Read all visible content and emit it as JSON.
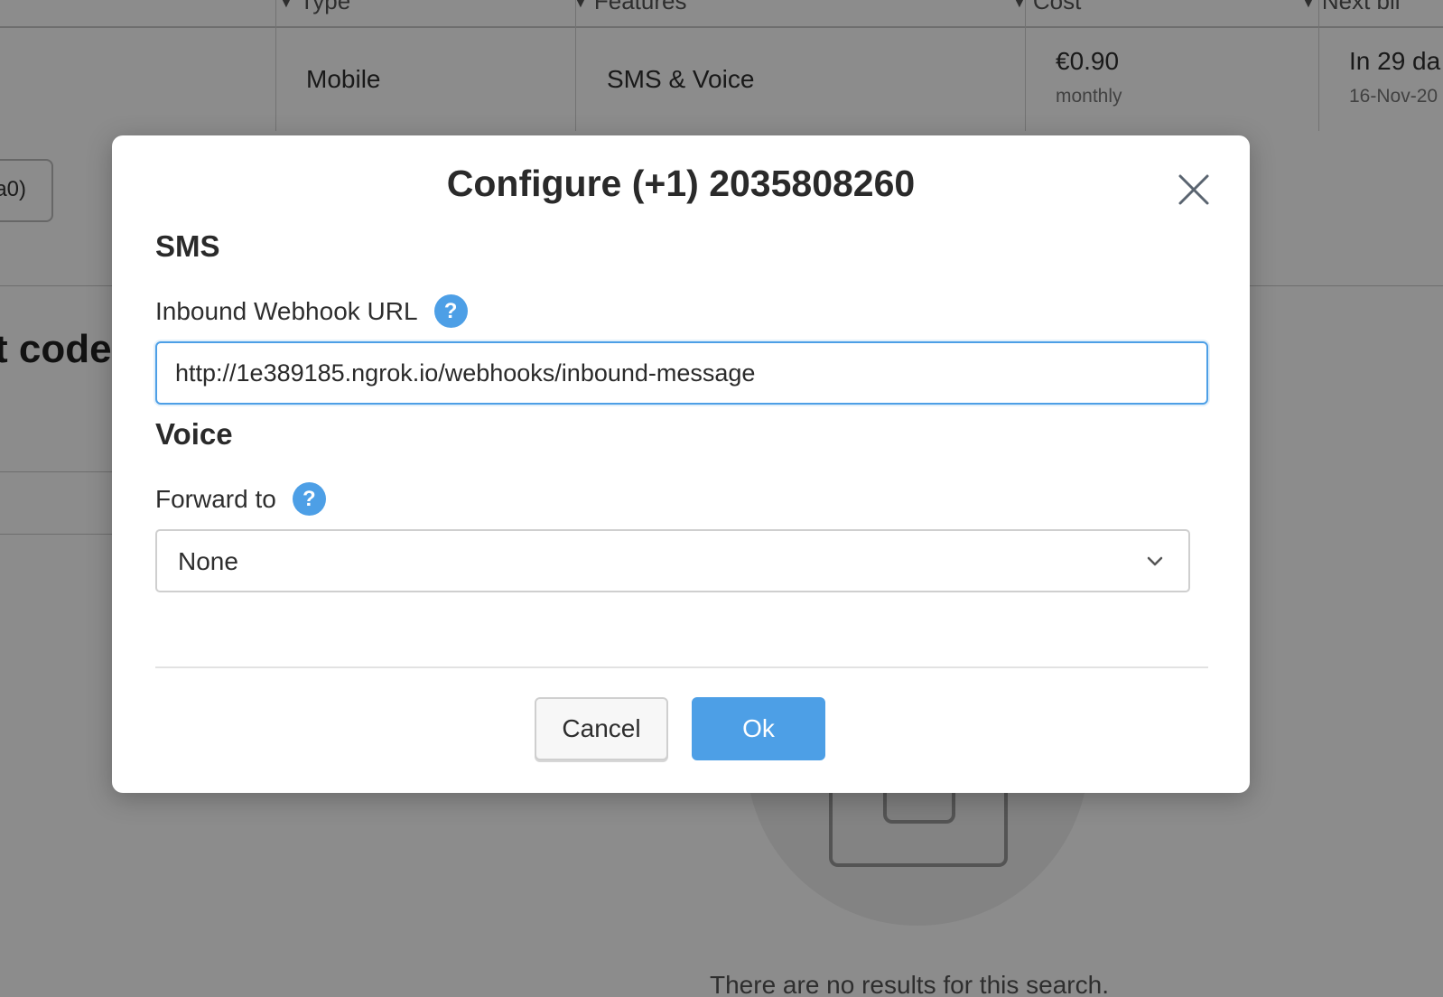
{
  "background": {
    "table": {
      "headers": [
        "Type",
        "Features",
        "Cost",
        "Next bil"
      ],
      "row": {
        "type": "Mobile",
        "features": "SMS & Voice",
        "cost": "€0.90",
        "cost_period": "monthly",
        "next_billing": "In 29 da",
        "next_billing_date": "16-Nov-20"
      }
    },
    "partial_button_label": "a0)",
    "partial_heading": "t code",
    "empty_state_text": "There are no results for this search."
  },
  "modal": {
    "title": "Configure (+1) 2035808260",
    "close_icon": "close-icon",
    "sms": {
      "section_title": "SMS",
      "webhook_label": "Inbound Webhook URL",
      "webhook_value": "http://1e389185.ngrok.io/webhooks/inbound-message",
      "help_glyph": "?"
    },
    "voice": {
      "section_title": "Voice",
      "forward_label": "Forward to",
      "forward_value": "None",
      "help_glyph": "?"
    },
    "buttons": {
      "cancel": "Cancel",
      "ok": "Ok"
    }
  },
  "colors": {
    "accent": "#4d9fe6",
    "overlay": "rgba(0,0,0,0.45)"
  }
}
